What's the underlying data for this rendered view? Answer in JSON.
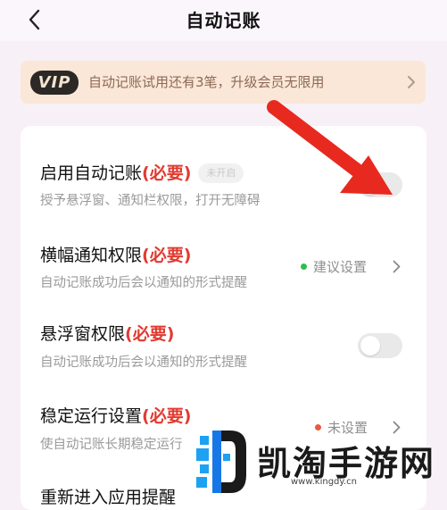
{
  "header": {
    "title": "自动记账"
  },
  "vip": {
    "badge": "VIP",
    "text": "自动记账试用还有3笔，升级会员无限用"
  },
  "settings": [
    {
      "title": "启用自动记账",
      "required": "(必要)",
      "tag": "未开启",
      "subtitle": "授予悬浮窗、通知栏权限，打开无障碍",
      "control": "toggle",
      "on": false
    },
    {
      "title": "横幅通知权限",
      "required": "(必要)",
      "subtitle": "自动记账成功后会以通知的形式提醒",
      "status": "建议设置",
      "status_color": "#2bc04a"
    },
    {
      "title": "悬浮窗权限",
      "required": "(必要)",
      "subtitle": "自动记账成功后会以通知的形式提醒",
      "control": "toggle",
      "on": false
    },
    {
      "title": "稳定运行设置",
      "required": "(必要)",
      "subtitle": "使自动记账长期稳定运行",
      "status": "未设置",
      "status_color": "#e85a3c"
    },
    {
      "title": "重新进入应用提醒"
    }
  ],
  "watermark": {
    "text": "凯淘手游网",
    "url": "www.kingdy.cn"
  },
  "colors": {
    "required": "#e23a30",
    "arrow": "#e8291f",
    "vip_bg": "#fbe7d8"
  }
}
